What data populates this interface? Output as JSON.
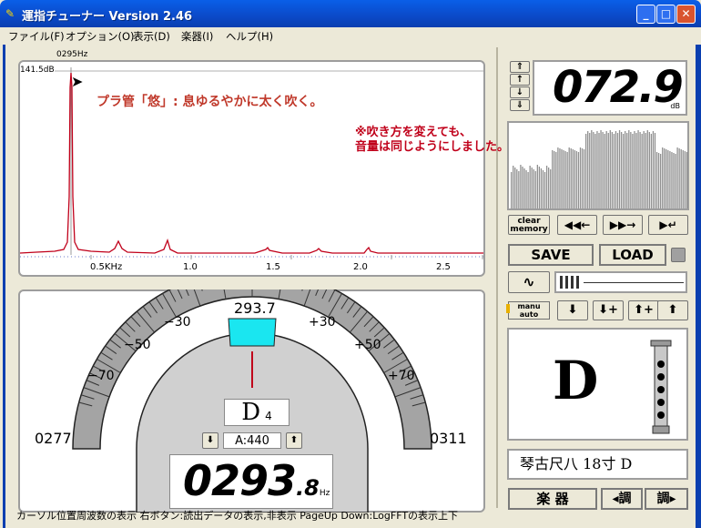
{
  "window": {
    "title": "運指チューナー  Version 2.46",
    "icon": "tuner-app-icon"
  },
  "menu": [
    "ファイル(F)",
    "オプション(O)",
    "表示(D)",
    "楽器(I)",
    "ヘルプ(H)"
  ],
  "spectrum": {
    "marker_freq": "0295Hz",
    "peak_label": "141.5dB",
    "annotation1": "プラ管「悠」: 息ゆるやかに太く吹く。",
    "annotation2_line1": "※吹き方を変えても、",
    "annotation2_line2": "音量は同じようにしました。⇒",
    "x_ticks": [
      "0.5KHz",
      "1.0",
      "1.5",
      "2.0",
      "2.5"
    ]
  },
  "tuner": {
    "center_freq": "293.7",
    "left_freq": "0277",
    "right_freq": "0311",
    "scale_left": [
      "−30",
      "−50",
      "−70"
    ],
    "scale_right": [
      "+30",
      "+50",
      "+70"
    ],
    "note": "D",
    "octave": "4",
    "a_ref": "A:440",
    "readout_main": "0293",
    "readout_dec": ".8",
    "readout_unit": "Hz"
  },
  "level": {
    "value": "072.9",
    "unit": "dB"
  },
  "side": {
    "clear_memory": "clear\nmemory",
    "save": "SAVE",
    "load": "LOAD",
    "manu": "manu",
    "auto": "auto",
    "fingering_note": "D",
    "instrument_name": "琴古尺八  18寸 D",
    "instrument_btn": "楽 器",
    "tune_down": "◂調",
    "tune_up": "調▸"
  },
  "status": "カーソル位置周波数の表示  右ボタン:読出データの表示,非表示  PageUp Down:LogFFTの表示上下",
  "colors": {
    "accent_cyan": "#1ae6f0",
    "spectrum_line": "#c0001a",
    "titlebar": "#0b49c8"
  }
}
